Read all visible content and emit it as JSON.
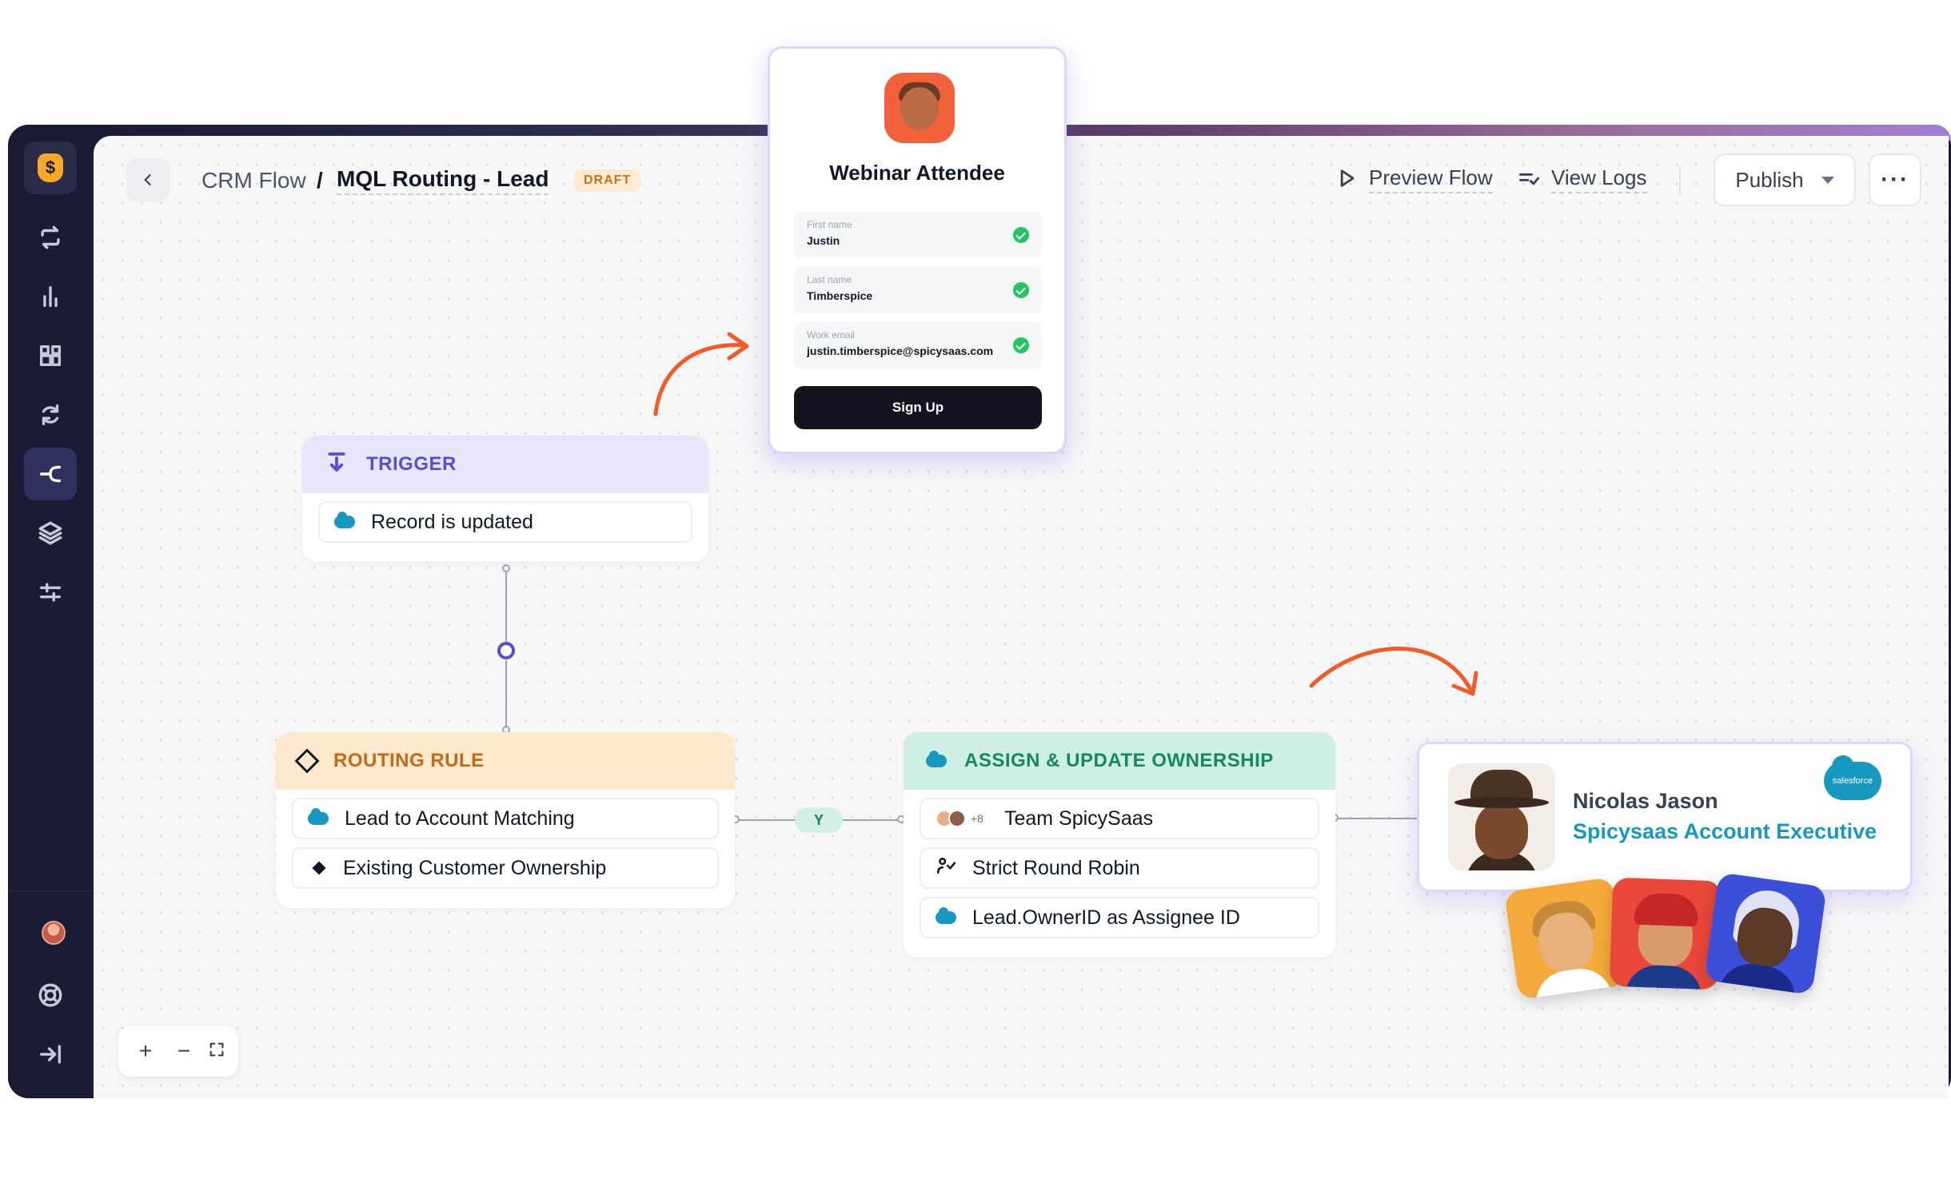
{
  "header": {
    "breadcrumb_root": "CRM Flow",
    "breadcrumb_sep": "/",
    "breadcrumb_current": "MQL Routing - Lead",
    "status_badge": "DRAFT",
    "preview_flow": "Preview Flow",
    "view_logs": "View Logs",
    "publish": "Publish",
    "more": "···"
  },
  "sidebar": {
    "icons": [
      "money-bag-icon",
      "loop-icon",
      "bar-chart-icon",
      "widgets-icon",
      "refresh-flow-icon",
      "routing-icon",
      "layers-icon",
      "sliders-icon",
      "avatar",
      "help-ring-icon",
      "collapse-icon"
    ],
    "active": "routing-icon"
  },
  "webinar": {
    "title": "Webinar Attendee",
    "fields": [
      {
        "label": "First name",
        "value": "Justin"
      },
      {
        "label": "Last name",
        "value": "Timberspice"
      },
      {
        "label": "Work email",
        "value": "justin.timberspice@spicysaas.com"
      }
    ],
    "button": "Sign Up"
  },
  "trigger": {
    "title": "TRIGGER",
    "rows": [
      "Record is updated"
    ]
  },
  "routing": {
    "title": "ROUTING RULE",
    "rows": [
      "Lead to Account Matching",
      "Existing Customer Ownership"
    ]
  },
  "branch_label": "Y",
  "assign": {
    "title": "ASSIGN & UPDATE OWNERSHIP",
    "team_extra": "+8",
    "rows": [
      "Team SpicySaas",
      "Strict Round Robin",
      "Lead.OwnerID as Assignee ID"
    ]
  },
  "exec": {
    "name": "Nicolas Jason",
    "role": "Spicysaas Account Executive",
    "logo_text": "salesforce"
  },
  "zoom": {
    "plus": "+",
    "minus": "−"
  },
  "colors": {
    "trigger_accent": "#5b4bd6",
    "routing_accent": "#c46a12",
    "assign_accent": "#138a5e",
    "arrow": "#f25a26",
    "salesforce": "#1798c1"
  }
}
